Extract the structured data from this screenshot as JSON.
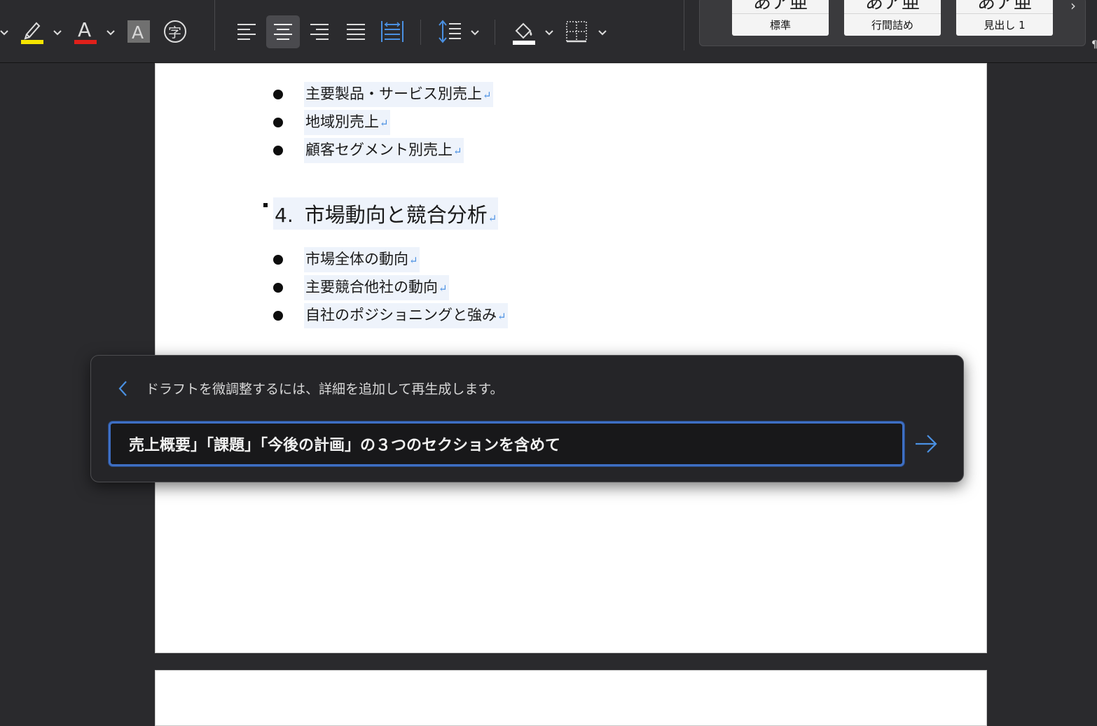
{
  "ribbon": {
    "styles": [
      {
        "preview": "あア亜",
        "label": "標準"
      },
      {
        "preview": "あア亜",
        "label": "行間詰め"
      },
      {
        "preview": "あア亜",
        "label": "見出し 1"
      }
    ],
    "font_color_glyph": "A",
    "char_shading_glyph": "A",
    "phonetic_guide_glyph": "字",
    "gallery_next_glyph": "›",
    "edge_glyph": "¶",
    "colors": {
      "highlight": "#f5e400",
      "font_color": "#e0201a",
      "accent": "#3e6fc4"
    }
  },
  "document": {
    "bullets_top": [
      "主要製品・サービス別売上",
      "地域別売上",
      "顧客セグメント別売上"
    ],
    "heading": {
      "number": "4.",
      "text": "市場動向と競合分析"
    },
    "bullets_bottom": [
      "市場全体の動向",
      "主要競合他社の動向",
      "自社のポジショニングと強み"
    ],
    "paragraph_mark": "↵"
  },
  "copilot": {
    "hint": "ドラフトを微調整するには、詳細を追加して再生成します。",
    "prompt_value": "売上概要」「課題」「今後の計画」の３つのセクションを含めて"
  }
}
